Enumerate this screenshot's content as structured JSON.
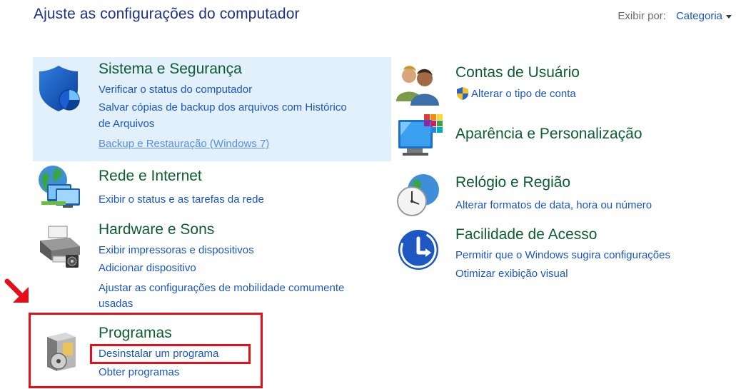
{
  "header": {
    "title": "Ajuste as configurações do computador",
    "view_by_label": "Exibir por:",
    "view_by_value": "Categoria"
  },
  "categories": {
    "system": {
      "title": "Sistema e Segurança",
      "links": [
        "Verificar o status do computador",
        "Salvar cópias de backup dos arquivos com Histórico",
        "de Arquivos",
        "Backup e Restauração (Windows 7)"
      ]
    },
    "network": {
      "title": "Rede e Internet",
      "links": [
        "Exibir o status e as tarefas da rede"
      ]
    },
    "hardware": {
      "title": "Hardware e Sons",
      "links": [
        "Exibir impressoras e dispositivos",
        "Adicionar dispositivo",
        "Ajustar as configurações de mobilidade comumente",
        "usadas"
      ]
    },
    "programs": {
      "title": "Programas",
      "links": [
        "Desinstalar um programa",
        "Obter programas"
      ]
    },
    "accounts": {
      "title": "Contas de Usuário",
      "links": [
        "Alterar o tipo de conta"
      ]
    },
    "appearance": {
      "title": "Aparência e Personalização",
      "links": []
    },
    "clock": {
      "title": "Relógio e Região",
      "links": [
        "Alterar formatos de data, hora ou número"
      ]
    },
    "ease": {
      "title": "Facilidade de Acesso",
      "links": [
        "Permitir que o Windows sugira configurações",
        "Otimizar exibição visual"
      ]
    }
  },
  "colors": {
    "title": "#1e3287",
    "category_title": "#0d5c32",
    "link": "#1a56c4",
    "highlight": "#e1f0fb",
    "annotation": "#e3101b"
  }
}
